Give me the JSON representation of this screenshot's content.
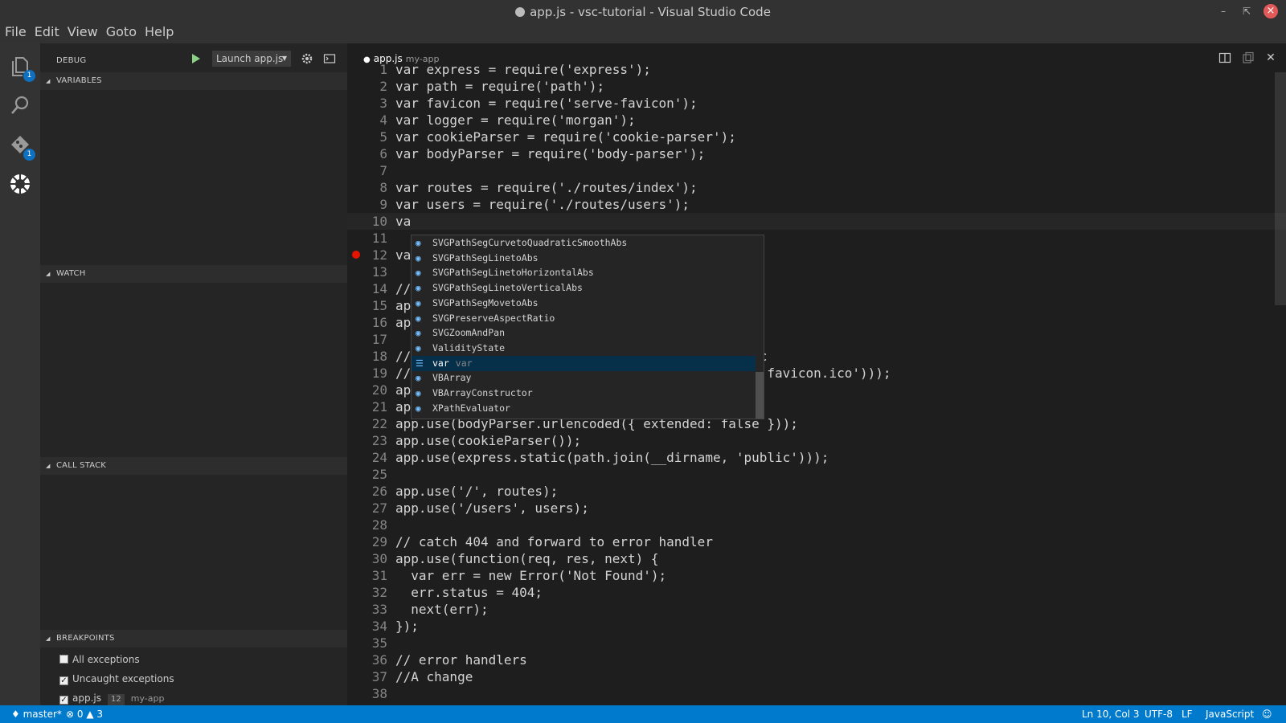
{
  "window": {
    "title": "app.js - vsc-tutorial - Visual Studio Code",
    "dirty": true
  },
  "menu": [
    "File",
    "Edit",
    "View",
    "Goto",
    "Help"
  ],
  "activity": {
    "explorer_badge": "1",
    "git_badge": "1"
  },
  "debug": {
    "title": "DEBUG",
    "config": "Launch app.js",
    "sections": {
      "variables": "VARIABLES",
      "watch": "WATCH",
      "callstack": "CALL STACK",
      "breakpoints": "BREAKPOINTS"
    },
    "breakpoints": [
      {
        "label": "All exceptions",
        "checked": false
      },
      {
        "label": "Uncaught exceptions",
        "checked": true
      },
      {
        "label": "app.js",
        "line": "12",
        "folder": "my-app",
        "checked": true
      }
    ]
  },
  "editor": {
    "tab": {
      "name": "app.js",
      "folder": "my-app"
    },
    "current_line": 10,
    "breakpoint_line": 12,
    "lines": [
      "var express = require('express');",
      "var path = require('path');",
      "var favicon = require('serve-favicon');",
      "var logger = require('morgan');",
      "var cookieParser = require('cookie-parser');",
      "var bodyParser = require('body-parser');",
      "",
      "var routes = require('./routes/index');",
      "var users = require('./routes/users');",
      "va",
      "",
      "va",
      "",
      "//",
      "app                                           );",
      "app",
      "",
      "//                                          blic",
      "//                                          ', 'favicon.ico')));",
      "app",
      "app",
      "app.use(bodyParser.urlencoded({ extended: false }));",
      "app.use(cookieParser());",
      "app.use(express.static(path.join(__dirname, 'public')));",
      "",
      "app.use('/', routes);",
      "app.use('/users', users);",
      "",
      "// catch 404 and forward to error handler",
      "app.use(function(req, res, next) {",
      "  var err = new Error('Not Found');",
      "  err.status = 404;",
      "  next(err);",
      "});",
      "",
      "// error handlers",
      "//A change",
      ""
    ]
  },
  "suggestions": [
    {
      "label": "SVGPathSegCurvetoQuadraticSmoothAbs",
      "kind": "class"
    },
    {
      "label": "SVGPathSegLinetoAbs",
      "kind": "class"
    },
    {
      "label": "SVGPathSegLinetoHorizontalAbs",
      "kind": "class"
    },
    {
      "label": "SVGPathSegLinetoVerticalAbs",
      "kind": "class"
    },
    {
      "label": "SVGPathSegMovetoAbs",
      "kind": "class"
    },
    {
      "label": "SVGPreserveAspectRatio",
      "kind": "class"
    },
    {
      "label": "SVGZoomAndPan",
      "kind": "class"
    },
    {
      "label": "ValidityState",
      "kind": "class"
    },
    {
      "label": "var",
      "kind": "keyword",
      "detail": "var",
      "selected": true
    },
    {
      "label": "VBArray",
      "kind": "class"
    },
    {
      "label": "VBArrayConstructor",
      "kind": "class"
    },
    {
      "label": "XPathEvaluator",
      "kind": "class"
    }
  ],
  "status": {
    "branch": "master*",
    "errors": "0",
    "warnings": "3",
    "position": "Ln 10, Col 3",
    "encoding": "UTF-8",
    "eol": "LF",
    "language": "JavaScript"
  }
}
